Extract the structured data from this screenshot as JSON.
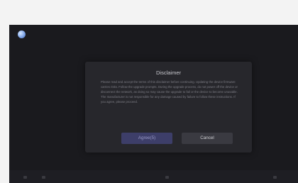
{
  "background": {
    "left_text": "",
    "right_text": ""
  },
  "dialog": {
    "title": "Disclaimer",
    "body": "Please read and accept the terms of this disclaimer before continuing. Updating the device firmware carries risks. Follow the upgrade prompts. During the upgrade process, do not power off the device or disconnect the network, as doing so may cause the upgrade to fail or the device to become unusable. The manufacturer is not responsible for any damage caused by failure to follow these instructions. If you agree, please proceed.",
    "agree_label": "Agree(5)",
    "cancel_label": "Cancel"
  },
  "colors": {
    "screen_bg": "#1a1a1e",
    "dialog_bg": "#27272c",
    "agree_bg": "#3d3e69",
    "cancel_bg": "#3a3a41"
  },
  "icons": {
    "top_left": "globe-icon"
  }
}
